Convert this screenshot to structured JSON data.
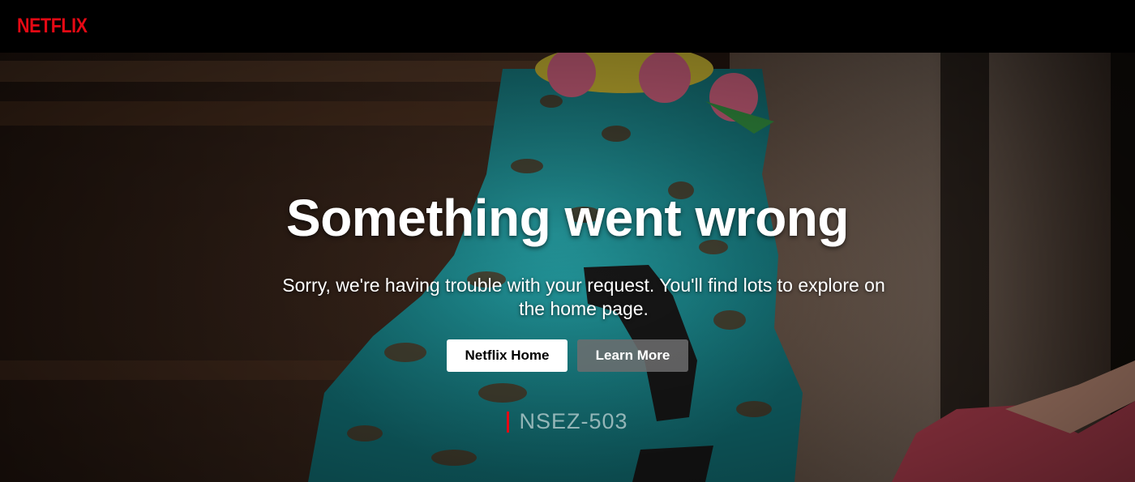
{
  "header": {
    "logo_text": "NETFLIX",
    "logo_color": "#e50914"
  },
  "error": {
    "title": "Something went wrong",
    "message": "Sorry, we're having trouble with your request. You'll find lots to explore on the home page.",
    "code": "NSEZ-503"
  },
  "buttons": {
    "home_label": "Netflix Home",
    "learn_more_label": "Learn More"
  },
  "colors": {
    "accent": "#e50914",
    "cake_frosting": "#1fa3a8",
    "hand": "#c9475a"
  }
}
